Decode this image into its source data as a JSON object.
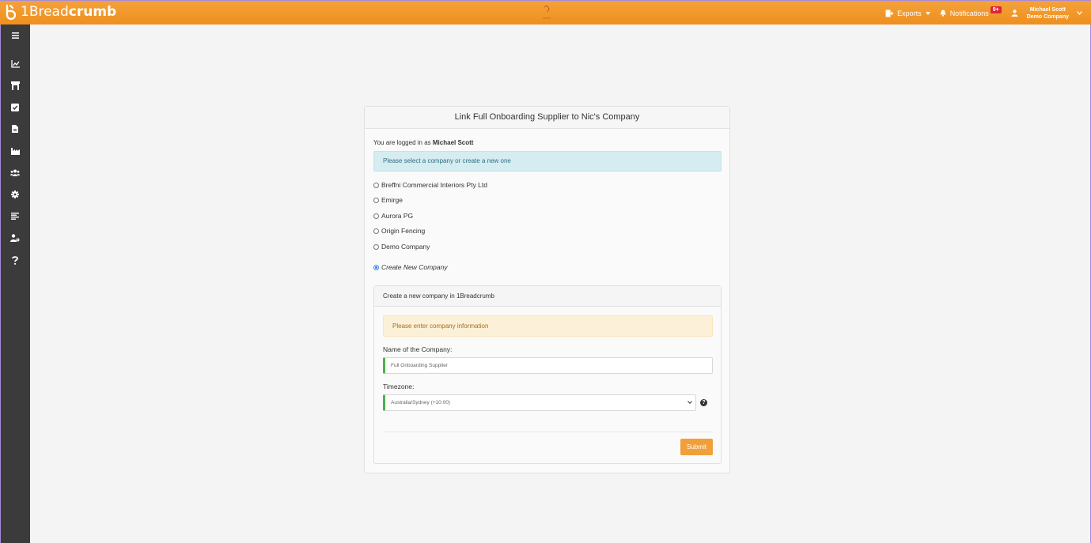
{
  "header": {
    "brand_prefix": "1Bread",
    "brand_suffix": "crumb",
    "exports_label": "Exports",
    "notifications_label": "Notifications",
    "notifications_badge": "9+",
    "user_name": "Michael Scott",
    "user_company": "Demo Company",
    "brand_color": "#ef8f1e"
  },
  "sidebar": {
    "icons": [
      "menu-icon",
      "chart-line-icon",
      "store-icon",
      "checkbox-icon",
      "document-icon",
      "factory-icon",
      "users-icon",
      "gear-icon",
      "align-left-icon",
      "user-cog-icon",
      "question-icon"
    ]
  },
  "card": {
    "title": "Link Full Onboarding Supplier to Nic's Company",
    "logged_prefix": "You are logged in as",
    "logged_user": "Michael Scott",
    "info_alert": "Please select a company or create a new one",
    "companies": [
      "Breffni Commercial Interiors Pty Ltd",
      "Emirge",
      "Aurora PG",
      "Origin Fencing",
      "Demo Company"
    ],
    "create_new_label": "Create New Company",
    "selected": "Create New Company"
  },
  "create_form": {
    "header": "Create a new company in 1Breadcrumb",
    "warning": "Please enter company information",
    "name_label": "Name of the Company:",
    "name_value": "Full Onboarding Supplier",
    "timezone_label": "Timezone:",
    "timezone_value": "Australia/Sydney (+10:00)",
    "submit_label": "Submit"
  }
}
